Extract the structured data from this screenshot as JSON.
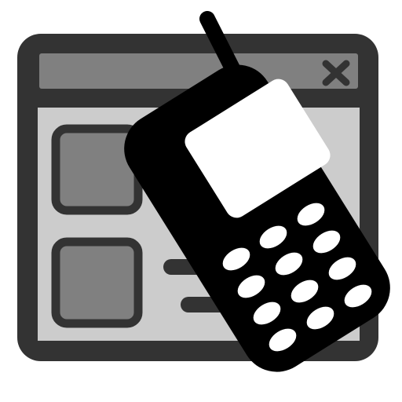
{
  "icon": {
    "name": "window-with-mobile-phone-icon",
    "colors": {
      "outline": "#333333",
      "titlebar": "#808080",
      "window_body": "#cccccc",
      "thumbnail": "#808080",
      "phone_body": "#000000",
      "phone_screen": "#ffffff",
      "phone_keys": "#ffffff"
    },
    "window": {
      "close_glyph": "close-icon",
      "thumbnail_count": 2,
      "text_line_count": 2
    },
    "phone": {
      "key_count": 12,
      "has_antenna": true
    }
  }
}
